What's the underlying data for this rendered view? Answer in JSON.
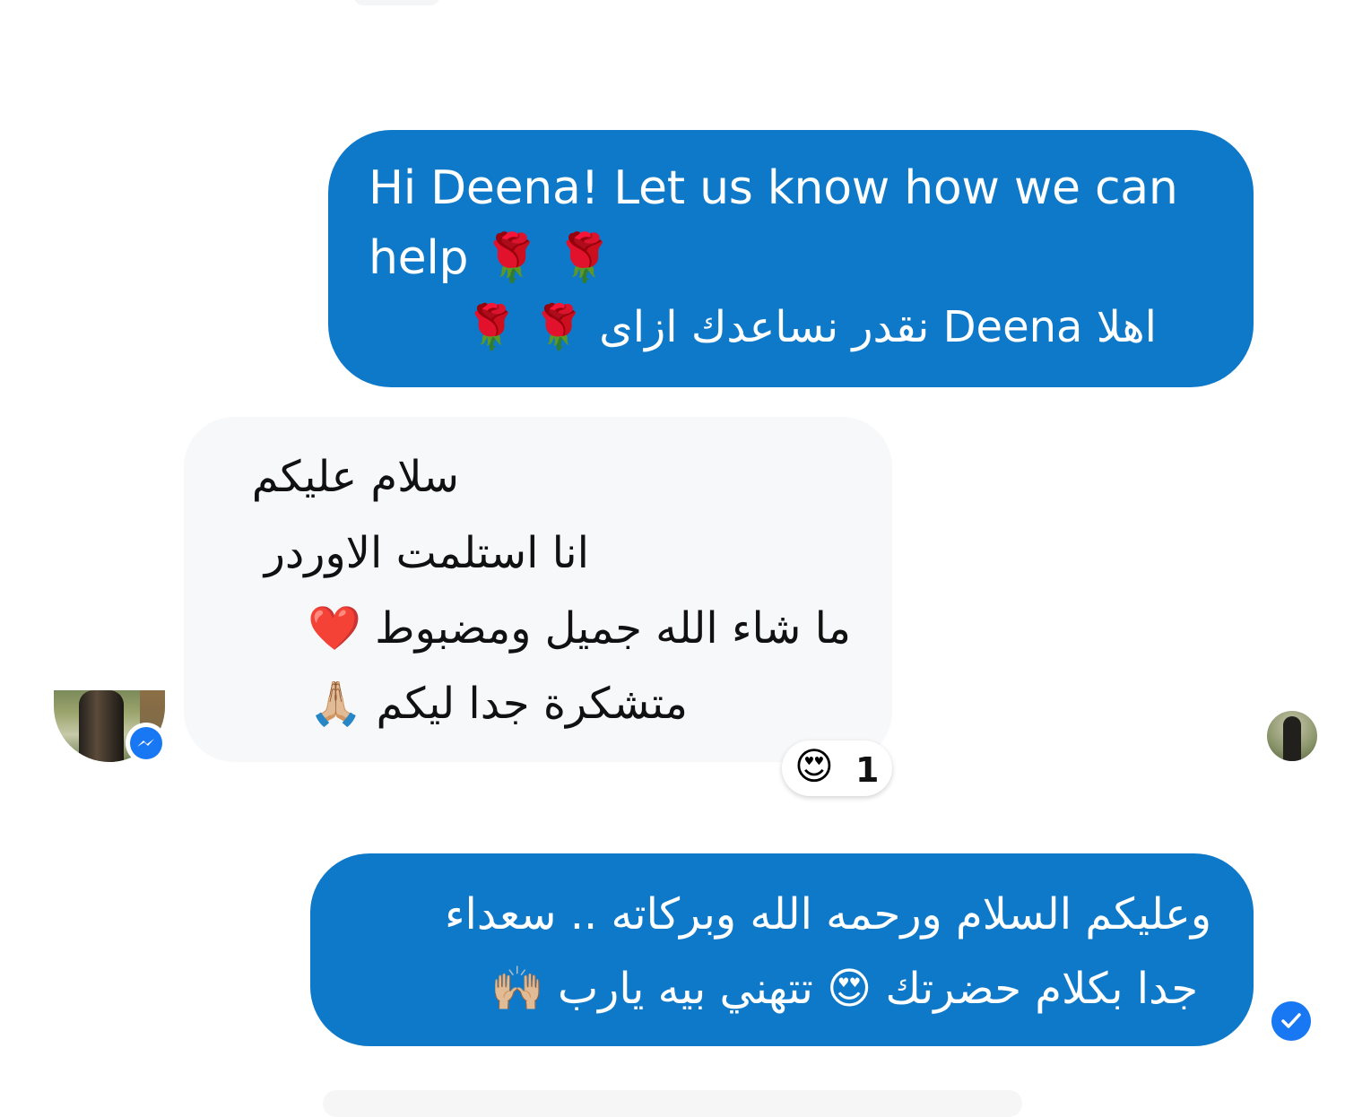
{
  "conversation": {
    "messages": [
      {
        "direction": "outgoing",
        "lines": [
          "Hi Deena!  Let us know how we can",
          "help 🌹 🌹",
          "اهلا Deena نقدر نساعدك ازاى 🌹 🌹"
        ]
      },
      {
        "direction": "incoming",
        "lines": [
          "سلام عليكم",
          "انا استلمت الاوردر",
          "ما شاء الله جميل ومضبوط ❤️",
          "متشكرة  جدا ليكم 🙏🏼"
        ],
        "reaction": {
          "emoji": "😍",
          "count": "1"
        }
      },
      {
        "direction": "outgoing",
        "lines": [
          "وعليكم السلام ورحمه الله وبركاته .. سعداء",
          "جدا بكلام حضرتك 😍 تتهني بيه يارب 🙌🏼"
        ]
      }
    ]
  },
  "icons": {
    "sender_badge": "messenger-icon",
    "seen_indicator": "avatar",
    "delivered_indicator": "check-circle-icon"
  },
  "colors": {
    "outgoing_bubble": "#0f79c9",
    "incoming_bubble": "#f7f8fa",
    "accent": "#1877f2",
    "background": "#ffffff"
  }
}
